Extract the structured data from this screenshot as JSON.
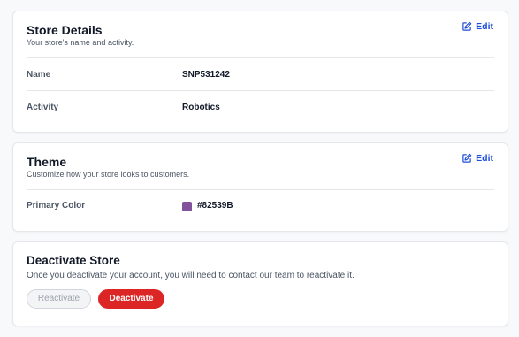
{
  "store_details": {
    "title": "Store Details",
    "subtitle": "Your store's name and activity.",
    "edit_label": "Edit",
    "rows": [
      {
        "label": "Name",
        "value": "SNP531242"
      },
      {
        "label": "Activity",
        "value": "Robotics"
      }
    ]
  },
  "theme": {
    "title": "Theme",
    "subtitle": "Customize how your store looks to customers.",
    "edit_label": "Edit",
    "primary_color_label": "Primary Color",
    "primary_color_value": "#82539B",
    "swatch_color": "#82539B"
  },
  "deactivate": {
    "title": "Deactivate Store",
    "description": "Once you deactivate your account, you will need to contact our team to reactivate it.",
    "reactivate_label": "Reactivate",
    "deactivate_label": "Deactivate"
  },
  "colors": {
    "accent": "#1D4ED8",
    "danger": "#DC2626"
  },
  "icons": {
    "edit": "edit-icon"
  }
}
